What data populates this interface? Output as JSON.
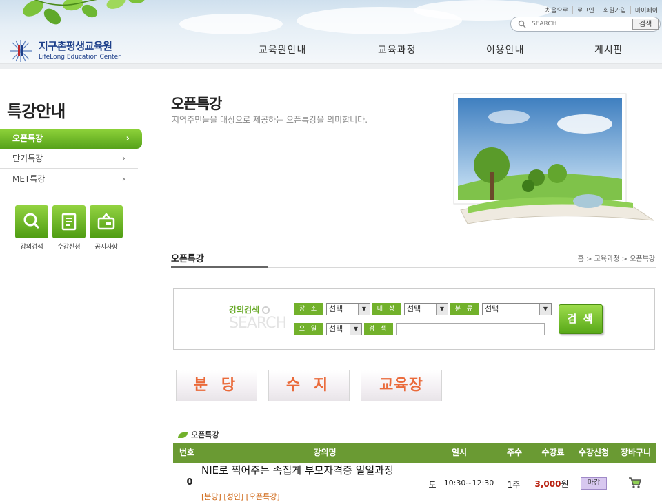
{
  "header": {
    "logo_title": "지구촌평생교육원",
    "logo_subtitle": "LifeLong Education Center",
    "util_links": [
      "처음으로",
      "로그인",
      "회원가입",
      "마이페이"
    ],
    "search_placeholder": "SEARCH",
    "search_button": "검색",
    "nav": [
      "교육원안내",
      "교육과정",
      "이용안내",
      "게시판"
    ]
  },
  "sidebar": {
    "title": "특강안내",
    "items": [
      {
        "label": "오픈특강",
        "active": true
      },
      {
        "label": "단기특강",
        "active": false
      },
      {
        "label": "MET특강",
        "active": false
      }
    ],
    "quick_links": [
      {
        "label": "강의검색",
        "icon": "magnifier-icon"
      },
      {
        "label": "수강신청",
        "icon": "document-icon"
      },
      {
        "label": "공지사항",
        "icon": "notice-icon"
      }
    ]
  },
  "main": {
    "title": "오픈특강",
    "description": "지역주민들을 대상으로 제공하는 오픈특강을 의미합니다.",
    "section_title": "오픈특강",
    "breadcrumb": [
      "홈",
      "교육과정",
      "오픈특강"
    ],
    "search_panel": {
      "title": "강의검색",
      "title_en": "SEARCH",
      "filters": [
        {
          "label": "장 소",
          "value": "선택"
        },
        {
          "label": "대 상",
          "value": "선택"
        },
        {
          "label": "분 류",
          "value": "선택"
        },
        {
          "label": "요 일",
          "value": "선택"
        }
      ],
      "keyword_label": "검 색",
      "keyword_value": "",
      "button": "검 색"
    },
    "location_buttons": [
      "분 당",
      "수 지",
      "교육장"
    ],
    "list_title": "오픈특강",
    "table": {
      "headers": [
        "번호",
        "강의명",
        "일시",
        "주수",
        "수강료",
        "수강신청",
        "장바구니"
      ],
      "rows": [
        {
          "no": "0",
          "title": "NIE로 찍어주는 족집게 부모자격증 일일과정",
          "tags": "[분당] [성인] [오픈특강]",
          "day": "토",
          "time": "10:30~12:30",
          "weeks": "1주",
          "fee": "3,000",
          "fee_unit": "원",
          "status": "마감"
        }
      ]
    }
  },
  "colors": {
    "accent_green": "#72b12b",
    "table_header": "#6a9a33",
    "location_text": "#ea6a3a",
    "fee_text": "#b8200f",
    "brand_blue": "#1d3f8a"
  }
}
